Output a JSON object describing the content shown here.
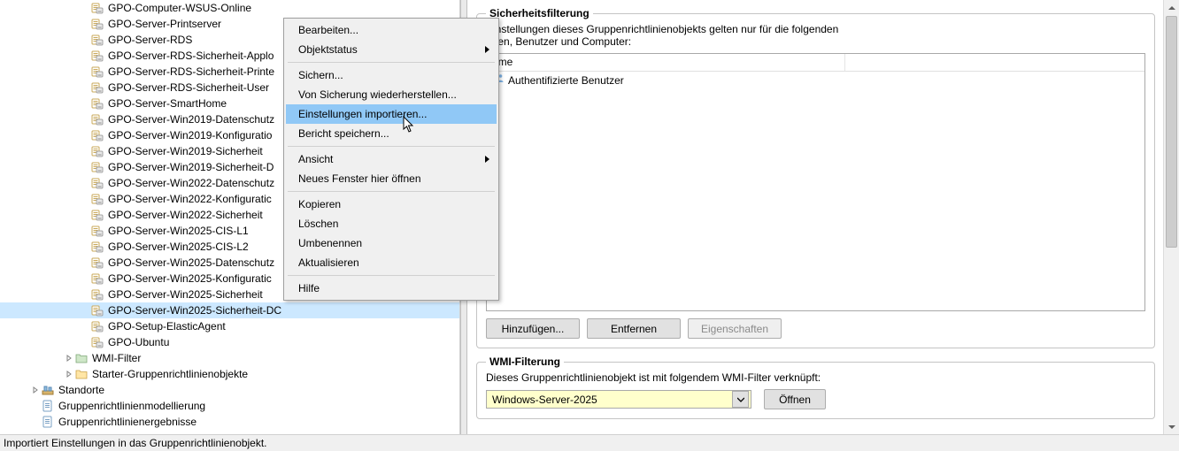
{
  "tree": {
    "gpo_items": [
      "GPO-Computer-WSUS-Online",
      "GPO-Server-Printserver",
      "GPO-Server-RDS",
      "GPO-Server-RDS-Sicherheit-Applo",
      "GPO-Server-RDS-Sicherheit-Printe",
      "GPO-Server-RDS-Sicherheit-User",
      "GPO-Server-SmartHome",
      "GPO-Server-Win2019-Datenschutz",
      "GPO-Server-Win2019-Konfiguratio",
      "GPO-Server-Win2019-Sicherheit",
      "GPO-Server-Win2019-Sicherheit-D",
      "GPO-Server-Win2022-Datenschutz",
      "GPO-Server-Win2022-Konfiguratic",
      "GPO-Server-Win2022-Sicherheit",
      "GPO-Server-Win2025-CIS-L1",
      "GPO-Server-Win2025-CIS-L2",
      "GPO-Server-Win2025-Datenschutz",
      "GPO-Server-Win2025-Konfiguratic",
      "GPO-Server-Win2025-Sicherheit",
      "GPO-Server-Win2025-Sicherheit-DC",
      "GPO-Setup-ElasticAgent",
      "GPO-Ubuntu"
    ],
    "selected_index": 19,
    "other_nodes": {
      "wmi": "WMI-Filter",
      "starter": "Starter-Gruppenrichtlinienobjekte",
      "standorte": "Standorte",
      "modellierung": "Gruppenrichtlinienmodellierung",
      "ergebnisse": "Gruppenrichtlinienergebnisse"
    }
  },
  "contextmenu": {
    "edit": "Bearbeiten...",
    "status": "Objektstatus",
    "backup": "Sichern...",
    "restore": "Von Sicherung wiederherstellen...",
    "import": "Einstellungen importieren...",
    "report": "Bericht speichern...",
    "view": "Ansicht",
    "newwin": "Neues Fenster hier öffnen",
    "copy": "Kopieren",
    "delete": "Löschen",
    "rename": "Umbenennen",
    "refresh": "Aktualisieren",
    "help": "Hilfe",
    "highlighted": "import"
  },
  "details": {
    "secfilter_title": "Sicherheitsfilterung",
    "secfilter_desc_line1": "Einstellungen dieses Gruppenrichtlinienobjekts gelten nur für die folgenden",
    "secfilter_desc_line2": "ppen, Benutzer und Computer:",
    "col_name": "ame",
    "row1": "Authentifizierte Benutzer",
    "btn_add": "Hinzufügen...",
    "btn_remove": "Entfernen",
    "btn_props": "Eigenschaften",
    "wmi_title": "WMI-Filterung",
    "wmi_desc": "Dieses Gruppenrichtlinienobjekt ist mit folgendem WMI-Filter verknüpft:",
    "wmi_value": "Windows-Server-2025",
    "btn_open": "Öffnen"
  },
  "status": "Importiert Einstellungen in das Gruppenrichtlinienobjekt."
}
